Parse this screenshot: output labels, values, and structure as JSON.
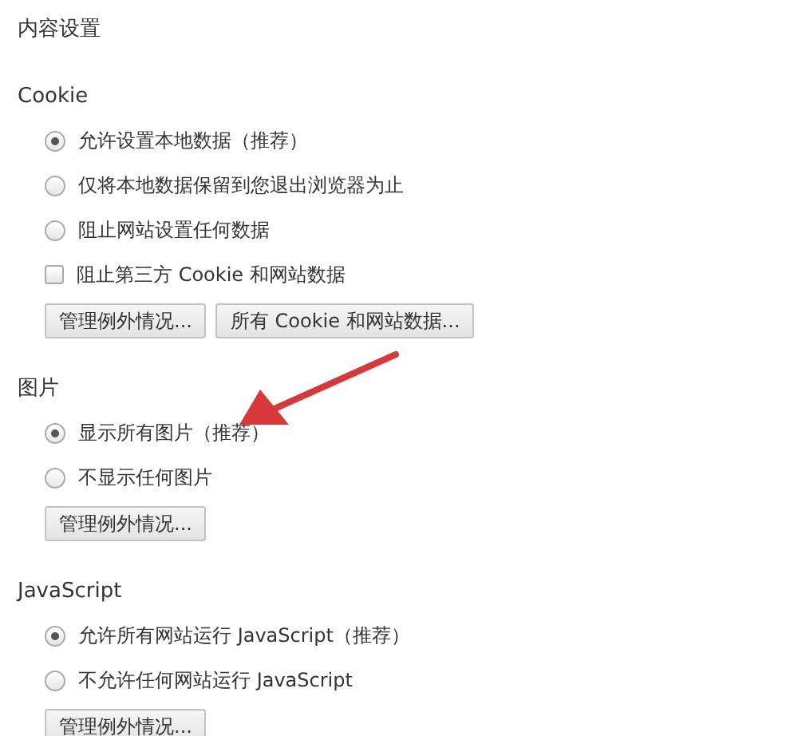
{
  "title": "内容设置",
  "sections": [
    {
      "heading": "Cookie",
      "options": [
        {
          "kind": "radio",
          "label": "允许设置本地数据（推荐）",
          "selected": true
        },
        {
          "kind": "radio",
          "label": "仅将本地数据保留到您退出浏览器为止",
          "selected": false
        },
        {
          "kind": "radio",
          "label": "阻止网站设置任何数据",
          "selected": false
        },
        {
          "kind": "checkbox",
          "label": "阻止第三方 Cookie 和网站数据",
          "checked": false
        }
      ],
      "buttons": [
        "管理例外情况...",
        "所有 Cookie 和网站数据..."
      ]
    },
    {
      "heading": "图片",
      "options": [
        {
          "kind": "radio",
          "label": "显示所有图片（推荐）",
          "selected": true
        },
        {
          "kind": "radio",
          "label": "不显示任何图片",
          "selected": false
        }
      ],
      "buttons": [
        "管理例外情况..."
      ]
    },
    {
      "heading": "JavaScript",
      "options": [
        {
          "kind": "radio",
          "label": "允许所有网站运行 JavaScript（推荐）",
          "selected": true
        },
        {
          "kind": "radio",
          "label": "不允许任何网站运行 JavaScript",
          "selected": false
        }
      ],
      "buttons": [
        "管理例外情况..."
      ]
    }
  ]
}
